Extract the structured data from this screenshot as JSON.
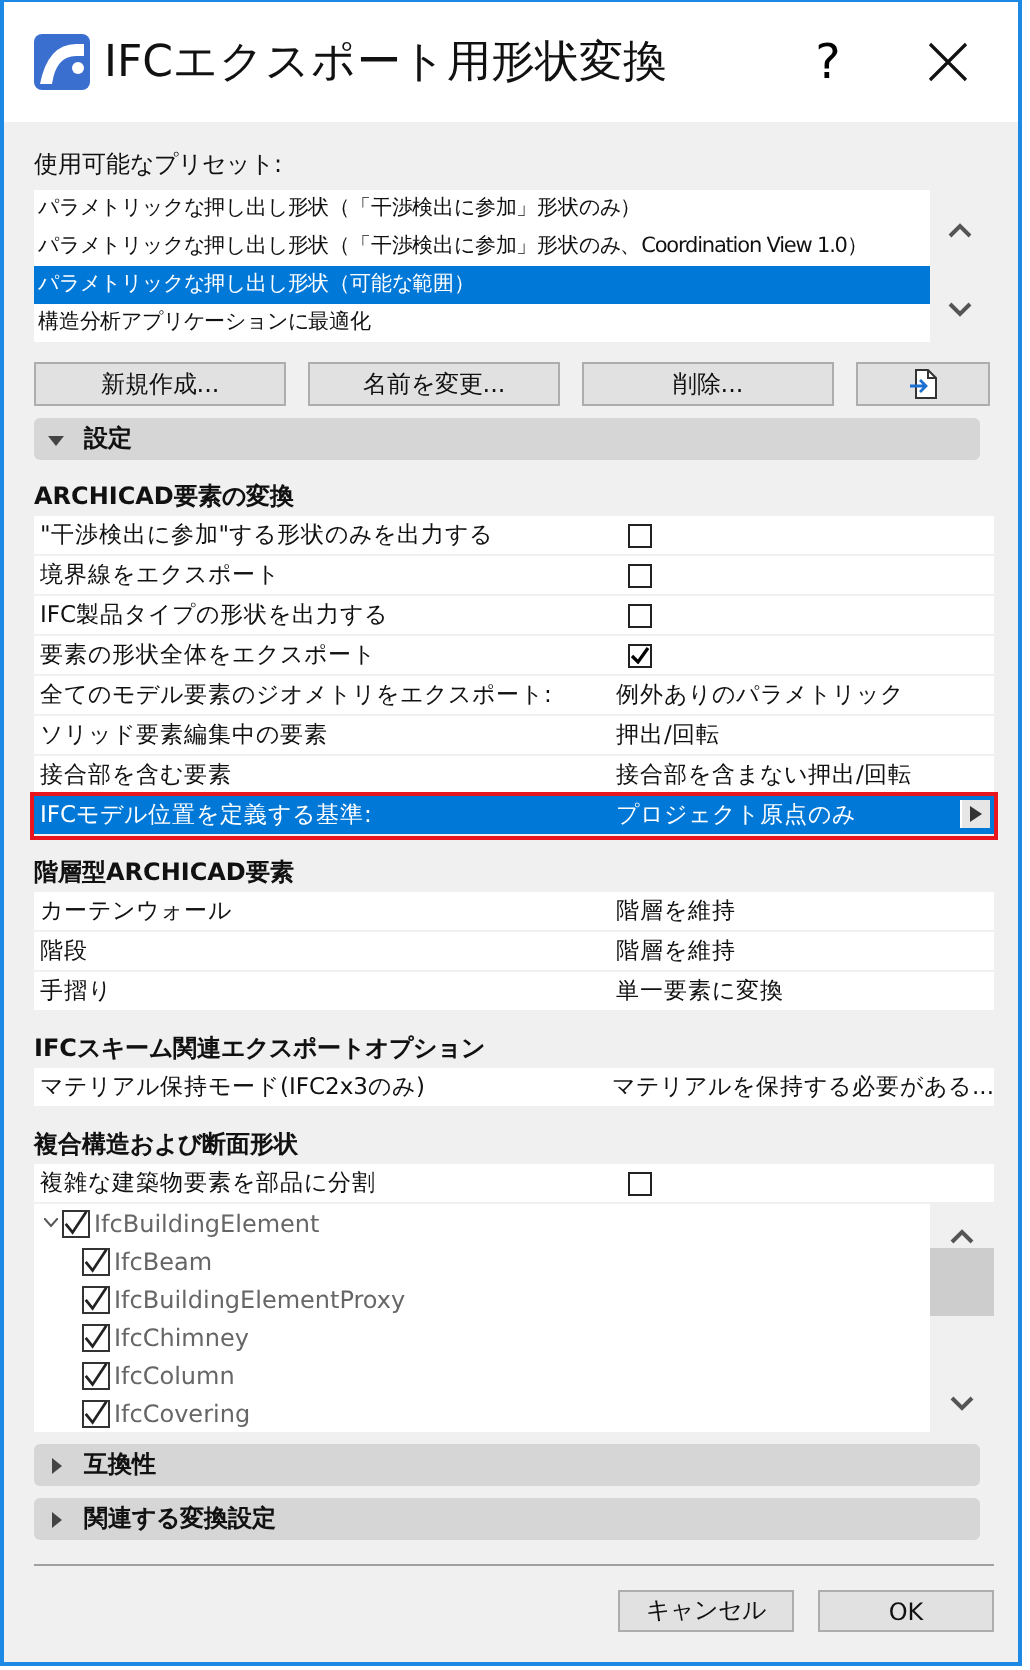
{
  "window": {
    "title": "IFCエクスポート用形状変換",
    "help": "?"
  },
  "presets": {
    "label": "使用可能なプリセット:",
    "items": [
      {
        "text": "パラメトリックな押し出し形状（「干渉検出に参加」形状のみ）",
        "selected": false
      },
      {
        "text": "パラメトリックな押し出し形状（「干渉検出に参加」形状のみ、Coordination View 1.0）",
        "selected": false
      },
      {
        "text": "パラメトリックな押し出し形状（可能な範囲）",
        "selected": true
      },
      {
        "text": "構造分析アプリケーションに最適化",
        "selected": false
      }
    ],
    "buttons": [
      "新規作成...",
      "名前を変更...",
      "削除..."
    ]
  },
  "panels": [
    {
      "title": "設定",
      "expanded": true,
      "sections": [
        {
          "title": "ARCHICAD要素の変換",
          "rows": [
            {
              "kind": "checkbox",
              "label": "\"干渉検出に参加\"する形状のみを出力する",
              "checked": false,
              "selected": false
            },
            {
              "kind": "checkbox",
              "label": "境界線をエクスポート",
              "checked": false,
              "selected": false
            },
            {
              "kind": "checkbox",
              "label": "IFC製品タイプの形状を出力する",
              "checked": false,
              "selected": false
            },
            {
              "kind": "checkbox",
              "label": "要素の形状全体をエクスポート",
              "checked": true,
              "selected": false
            },
            {
              "kind": "value",
              "label": "全てのモデル要素のジオメトリをエクスポート:",
              "value": "例外ありのパラメトリック",
              "selected": false
            },
            {
              "kind": "value",
              "label": "ソリッド要素編集中の要素",
              "value": "押出/回転",
              "selected": false
            },
            {
              "kind": "value",
              "label": "接合部を含む要素",
              "value": "接合部を含まない押出/回転",
              "selected": false
            },
            {
              "kind": "value",
              "label": "IFCモデル位置を定義する基準:",
              "value": "プロジェクト原点のみ",
              "selected": true
            }
          ]
        },
        {
          "title": "階層型ARCHICAD要素",
          "rows": [
            {
              "kind": "value",
              "label": "カーテンウォール",
              "value": "階層を維持",
              "selected": false
            },
            {
              "kind": "value",
              "label": "階段",
              "value": "階層を維持",
              "selected": false
            },
            {
              "kind": "value",
              "label": "手摺り",
              "value": "単一要素に変換",
              "selected": false
            }
          ]
        },
        {
          "title": "IFCスキーム関連エクスポートオプション",
          "rows": [
            {
              "kind": "value",
              "label": "マテリアル保持モード(IFC2x3のみ)",
              "value": "マテリアルを保持する必要がある...",
              "selected": false
            }
          ]
        },
        {
          "title": "複合構造および断面形状",
          "rows": [
            {
              "kind": "checkbox",
              "label": "複雑な建築物要素を部品に分割",
              "checked": false,
              "selected": false
            }
          ],
          "tree": [
            {
              "label": "IfcBuildingElement",
              "checked": true,
              "expanded": true,
              "children": [
                {
                  "label": "IfcBeam",
                  "checked": true
                },
                {
                  "label": "IfcBuildingElementProxy",
                  "checked": true
                },
                {
                  "label": "IfcChimney",
                  "checked": true
                },
                {
                  "label": "IfcColumn",
                  "checked": true
                },
                {
                  "label": "IfcCovering",
                  "checked": true
                }
              ]
            }
          ]
        }
      ]
    },
    {
      "title": "互換性",
      "expanded": false
    },
    {
      "title": "関連する変換設定",
      "expanded": false
    }
  ],
  "footer": {
    "buttons": [
      "キャンセル",
      "OK"
    ]
  }
}
